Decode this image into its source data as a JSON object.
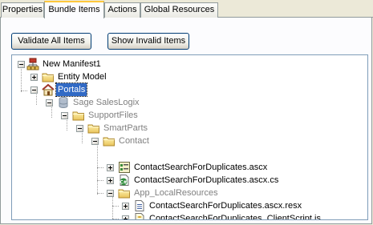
{
  "tabs": [
    {
      "label": "Properties"
    },
    {
      "label": "Bundle Items"
    },
    {
      "label": "Actions"
    },
    {
      "label": "Global Resources"
    }
  ],
  "toolbar": {
    "validate_label": "Validate All Items",
    "show_invalid_label": "Show Invalid Items"
  },
  "tree": {
    "root": {
      "label": "New Manifest1",
      "icon": "manifest-icon"
    },
    "entity_model": {
      "label": "Entity Model",
      "icon": "folder-icon"
    },
    "portals": {
      "label": "Portals",
      "icon": "home-icon"
    },
    "sage": {
      "label": "Sage SalesLogix",
      "icon": "database-icon"
    },
    "support_files": {
      "label": "SupportFiles",
      "icon": "folder-icon"
    },
    "smart_parts": {
      "label": "SmartParts",
      "icon": "folder-icon"
    },
    "contact": {
      "label": "Contact",
      "icon": "folder-icon"
    },
    "ascx": {
      "label": "ContactSearchForDuplicates.ascx",
      "icon": "ascx-file-icon"
    },
    "ascx_cs": {
      "label": "ContactSearchForDuplicates.ascx.cs",
      "icon": "csharp-file-icon"
    },
    "app_local": {
      "label": "App_LocalResources",
      "icon": "folder-icon"
    },
    "resx": {
      "label": "ContactSearchForDuplicates.ascx.resx",
      "icon": "resx-file-icon"
    },
    "js": {
      "label": "ContactSearchForDuplicates_ClientScript.js",
      "icon": "script-file-icon"
    }
  }
}
